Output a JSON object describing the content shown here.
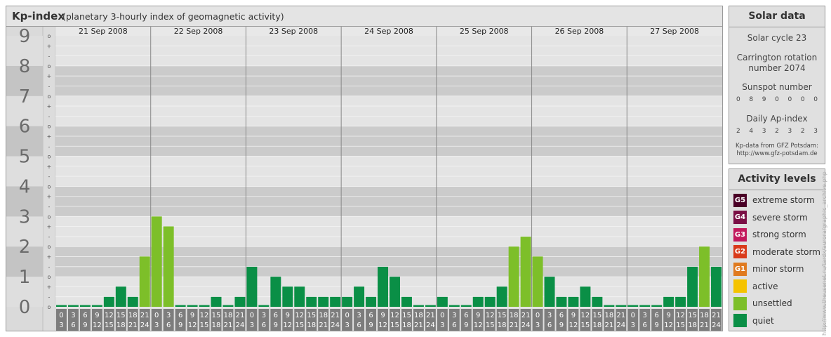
{
  "header": {
    "title": "Kp-index",
    "subtitle": "(planetary 3-hourly index of geomagnetic activity)"
  },
  "colors": {
    "quiet": "#0a8f46",
    "unsettled": "#7dbf29",
    "active": "#f5c300",
    "minor": "#e07a1f",
    "moderate": "#d93a1a",
    "strong": "#c2185b",
    "severe": "#7a0f45",
    "extreme": "#4a0026"
  },
  "chart_data": {
    "type": "bar",
    "ylim": [
      0,
      9
    ],
    "yticks": [
      "0",
      "1",
      "2",
      "3",
      "4",
      "5",
      "6",
      "7",
      "8",
      "9"
    ],
    "subticks": [
      "o",
      "-",
      "+"
    ],
    "days": [
      "21 Sep 2008",
      "22 Sep 2008",
      "23 Sep 2008",
      "24 Sep 2008",
      "25 Sep 2008",
      "26 Sep 2008",
      "27 Sep 2008"
    ],
    "interval_labels": [
      [
        "0",
        "3"
      ],
      [
        "3",
        "6"
      ],
      [
        "6",
        "9"
      ],
      [
        "9",
        "12"
      ],
      [
        "12",
        "15"
      ],
      [
        "15",
        "18"
      ],
      [
        "18",
        "21"
      ],
      [
        "21",
        "24"
      ]
    ],
    "values": [
      [
        0,
        0,
        0,
        0,
        0.33,
        0.67,
        0.33,
        1.67
      ],
      [
        3,
        2.67,
        0,
        0,
        0,
        0.33,
        0,
        0.33
      ],
      [
        1.33,
        0,
        1,
        0.67,
        0.67,
        0.33,
        0.33,
        0.33
      ],
      [
        0.33,
        0.67,
        0.33,
        1.33,
        1,
        0.33,
        0,
        0
      ],
      [
        0.33,
        0,
        0,
        0.33,
        0.33,
        0.67,
        2,
        2.33
      ],
      [
        1.67,
        1,
        0.33,
        0.33,
        0.67,
        0.33,
        0,
        0
      ],
      [
        0,
        0,
        0,
        0.33,
        0.33,
        1.33,
        2,
        1.33
      ]
    ]
  },
  "solar": {
    "title": "Solar data",
    "cycle": "Solar cycle 23",
    "carrington_1": "Carrington rotation",
    "carrington_2": "number 2074",
    "sunspot_label": "Sunspot number",
    "sunspot_values": [
      "0",
      "8",
      "9",
      "0",
      "0",
      "0",
      "0"
    ],
    "ap_label": "Daily Ap-index",
    "ap_values": [
      "2",
      "4",
      "3",
      "2",
      "3",
      "2",
      "3"
    ],
    "credit_1": "Kp-data from GFZ Potsdam:",
    "credit_2": "http://www.gfz-potsdam.de"
  },
  "activity": {
    "title": "Activity levels",
    "levels": [
      {
        "badge": "G5",
        "label": "extreme storm",
        "color": "#4a0026"
      },
      {
        "badge": "G4",
        "label": "severe storm",
        "color": "#7a0f45"
      },
      {
        "badge": "G3",
        "label": "strong storm",
        "color": "#c2185b"
      },
      {
        "badge": "G2",
        "label": "moderate storm",
        "color": "#d93a1a"
      },
      {
        "badge": "G1",
        "label": "minor storm",
        "color": "#e07a1f"
      },
      {
        "badge": "",
        "label": "active",
        "color": "#f5c300"
      },
      {
        "badge": "",
        "label": "unsettled",
        "color": "#7dbf29"
      },
      {
        "badge": "",
        "label": "quiet",
        "color": "#0a8f46"
      }
    ]
  },
  "watermark": "http://www.theusenet.ru/tardx/aurora/graphic_archive.php"
}
